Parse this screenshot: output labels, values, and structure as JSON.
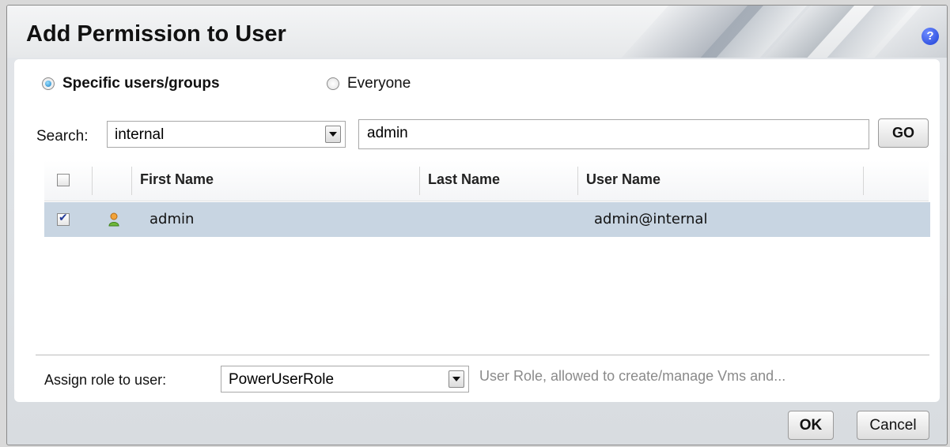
{
  "dialog": {
    "title": "Add Permission to User",
    "help_icon_label": "?"
  },
  "scope": {
    "options": [
      {
        "label": "Specific users/groups",
        "selected": true
      },
      {
        "label": "Everyone",
        "selected": false
      }
    ]
  },
  "search": {
    "label": "Search:",
    "domain_value": "internal",
    "query_value": "admin",
    "go_label": "GO"
  },
  "table": {
    "headers": {
      "first_name": "First Name",
      "last_name": "Last Name",
      "user_name": "User Name"
    },
    "header_checked": false,
    "rows": [
      {
        "checked": true,
        "icon": "user-icon",
        "first_name": "admin",
        "last_name": "",
        "user_name": "admin@internal"
      }
    ]
  },
  "role": {
    "label": "Assign role to user:",
    "value": "PowerUserRole",
    "description": "User Role, allowed to create/manage Vms and..."
  },
  "footer": {
    "ok_label": "OK",
    "cancel_label": "Cancel"
  },
  "colors": {
    "selected_row": "#c8d5e2",
    "help_icon": "#1c3fd6"
  }
}
